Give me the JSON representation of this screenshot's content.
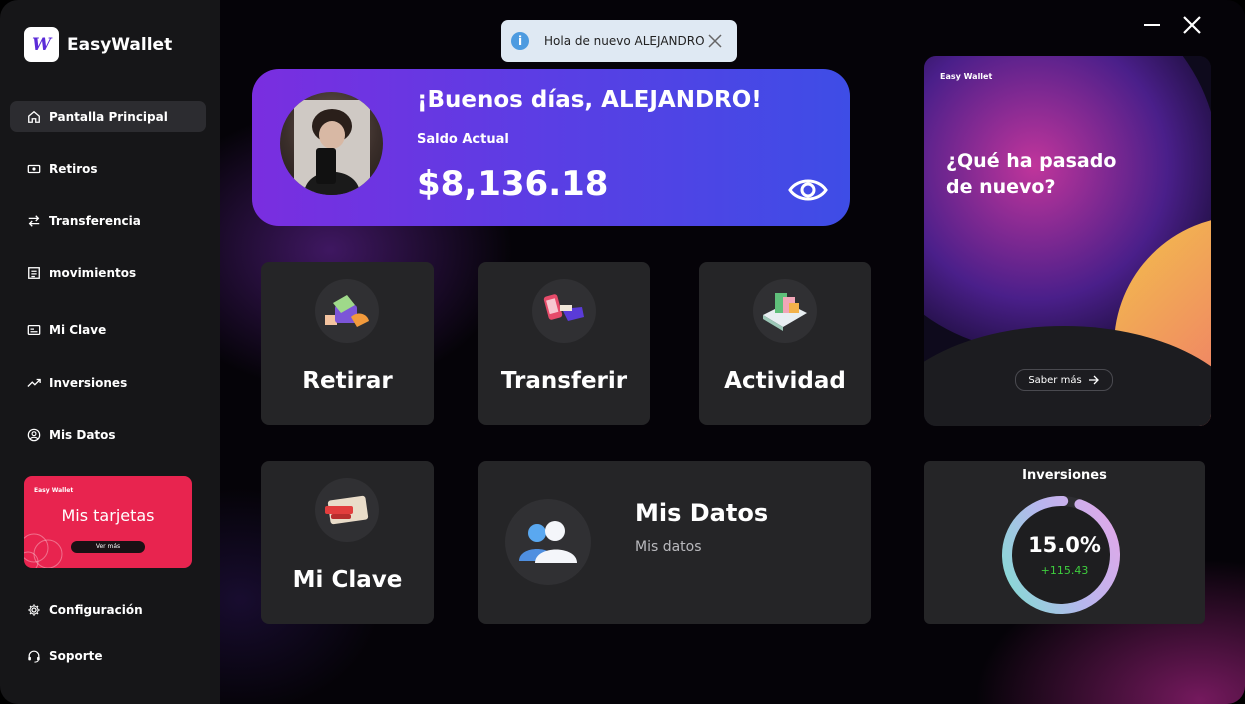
{
  "app": {
    "logo_glyph": "W",
    "name": "EasyWallet"
  },
  "sidebar": {
    "items": [
      {
        "label": "Pantalla Principal",
        "icon": "home-icon"
      },
      {
        "label": "Retiros",
        "icon": "cash-icon"
      },
      {
        "label": "Transferencia",
        "icon": "transfer-arrows-icon"
      },
      {
        "label": "movimientos",
        "icon": "list-icon"
      },
      {
        "label": "Mi Clave",
        "icon": "card-icon"
      },
      {
        "label": "Inversiones",
        "icon": "trending-up-icon"
      },
      {
        "label": "Mis Datos",
        "icon": "user-circle-icon"
      }
    ],
    "promo": {
      "brand": "Easy Wallet",
      "title": "Mis tarjetas",
      "button": "Ver más"
    },
    "footer": [
      {
        "label": "Configuración",
        "icon": "gear-icon"
      },
      {
        "label": "Soporte",
        "icon": "headset-icon"
      }
    ]
  },
  "toast": {
    "message": "Hola de nuevo ALEJANDRO",
    "icon": "info-icon"
  },
  "balance_card": {
    "greeting": "¡Buenos días, ALEJANDRO!",
    "balance_label": "Saldo Actual",
    "balance": "$8,136.18",
    "eye_icon": "eye-icon"
  },
  "tiles": {
    "retirar": "Retirar",
    "transferir": "Transferir",
    "actividad": "Actividad",
    "mi_clave": "Mi Clave",
    "mis_datos_title": "Mis Datos",
    "mis_datos_sub": "Mis datos"
  },
  "news": {
    "brand": "Easy Wallet",
    "title": "¿Qué ha pasado de nuevo?",
    "button": "Saber más"
  },
  "investments": {
    "title": "Inversiones",
    "percent": "15.0%",
    "delta": "+115.43",
    "progress": 0.95
  },
  "colors": {
    "accent_purple": "#7a2ee0",
    "accent_blue": "#3e4de6",
    "promo_red": "#e8244f",
    "positive": "#3ecf3e"
  }
}
